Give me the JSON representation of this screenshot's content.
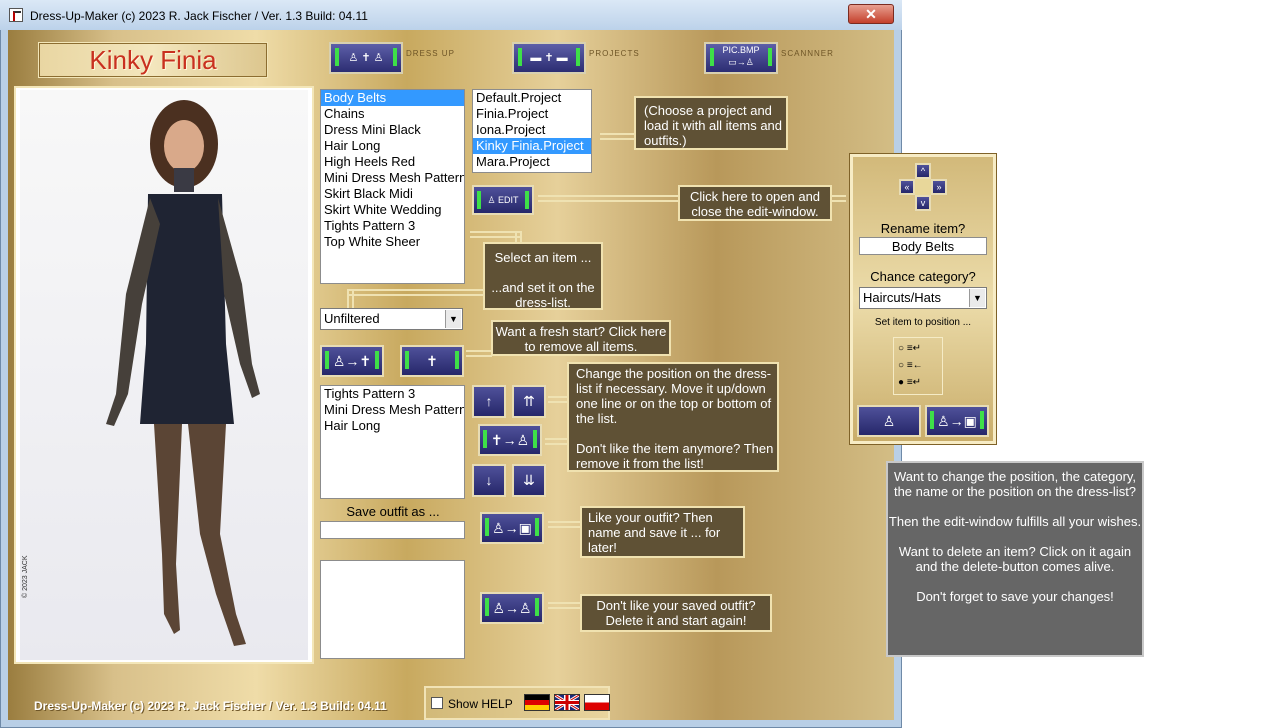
{
  "window": {
    "title": "Dress-Up-Maker (c) 2023 R. Jack Fischer / Ver. 1.3 Build: 04.11",
    "close_label": "✕"
  },
  "project_title": "Kinky Finia",
  "nav": [
    {
      "label": "DRESS UP"
    },
    {
      "label": "PROJECTS"
    },
    {
      "label": "SCANNNER",
      "button_text": "PIC.BMP"
    }
  ],
  "model": {
    "watermark": "© 2023 JACK"
  },
  "items_list": [
    "Body Belts",
    "Chains",
    "Dress Mini Black",
    "Hair Long",
    "High Heels Red",
    "Mini Dress Mesh Pattern",
    "Skirt Black Midi",
    "Skirt White Wedding",
    "Tights Pattern 3",
    "Top White Sheer"
  ],
  "items_selected": 0,
  "projects_list": [
    "Default.Project",
    "Finia.Project",
    "Iona.Project",
    "Kinky Finia.Project",
    "Mara.Project"
  ],
  "projects_selected": 3,
  "filter_value": "Unfiltered",
  "dress_list": [
    "Tights Pattern 3",
    "Mini Dress Mesh Pattern",
    "Hair Long"
  ],
  "save_outfit_label": "Save outfit as ...",
  "edit_button_label": "EDIT",
  "tips": {
    "project": "(Choose a project and load it with all items and outfits.)",
    "edit": "Click here to open and close the edit-window.",
    "select": "Select an item ...\n\n...and set it on the dress-list.",
    "fresh": "Want a fresh start? Click here to remove all items.",
    "position": "Change the position on the dress-list if necessary. Move it up/down one line or on the top or bottom of the list.\n\nDon't like the item anymore? Then remove it from the list!",
    "save": "Like your outfit? Then name and save it  ... for later!",
    "delete": "Don't like your saved outfit? Delete it and start again!"
  },
  "edit_panel": {
    "rename_label": "Rename item?",
    "rename_value": "Body Belts",
    "category_label": "Chance category?",
    "category_value": "Haircuts/Hats",
    "position_label": "Set item to position ..."
  },
  "info_panel": "Want to change the position, the category, the name or the position on the dress-list?\n\nThen the edit-window fulfills all your wishes.\n\nWant to delete an item? Click on it again and the delete-button comes alive.\n\nDon't forget to save your changes!",
  "footer": {
    "version": "Dress-Up-Maker (c) 2023 R. Jack Fischer / Ver. 1.3 Build: 04.11",
    "help_label": "Show HELP"
  },
  "colors": {
    "gold": "#d8c08a",
    "title_red": "#c9301f",
    "selection": "#3399ff",
    "tooltip_bg": "#5f5135"
  }
}
